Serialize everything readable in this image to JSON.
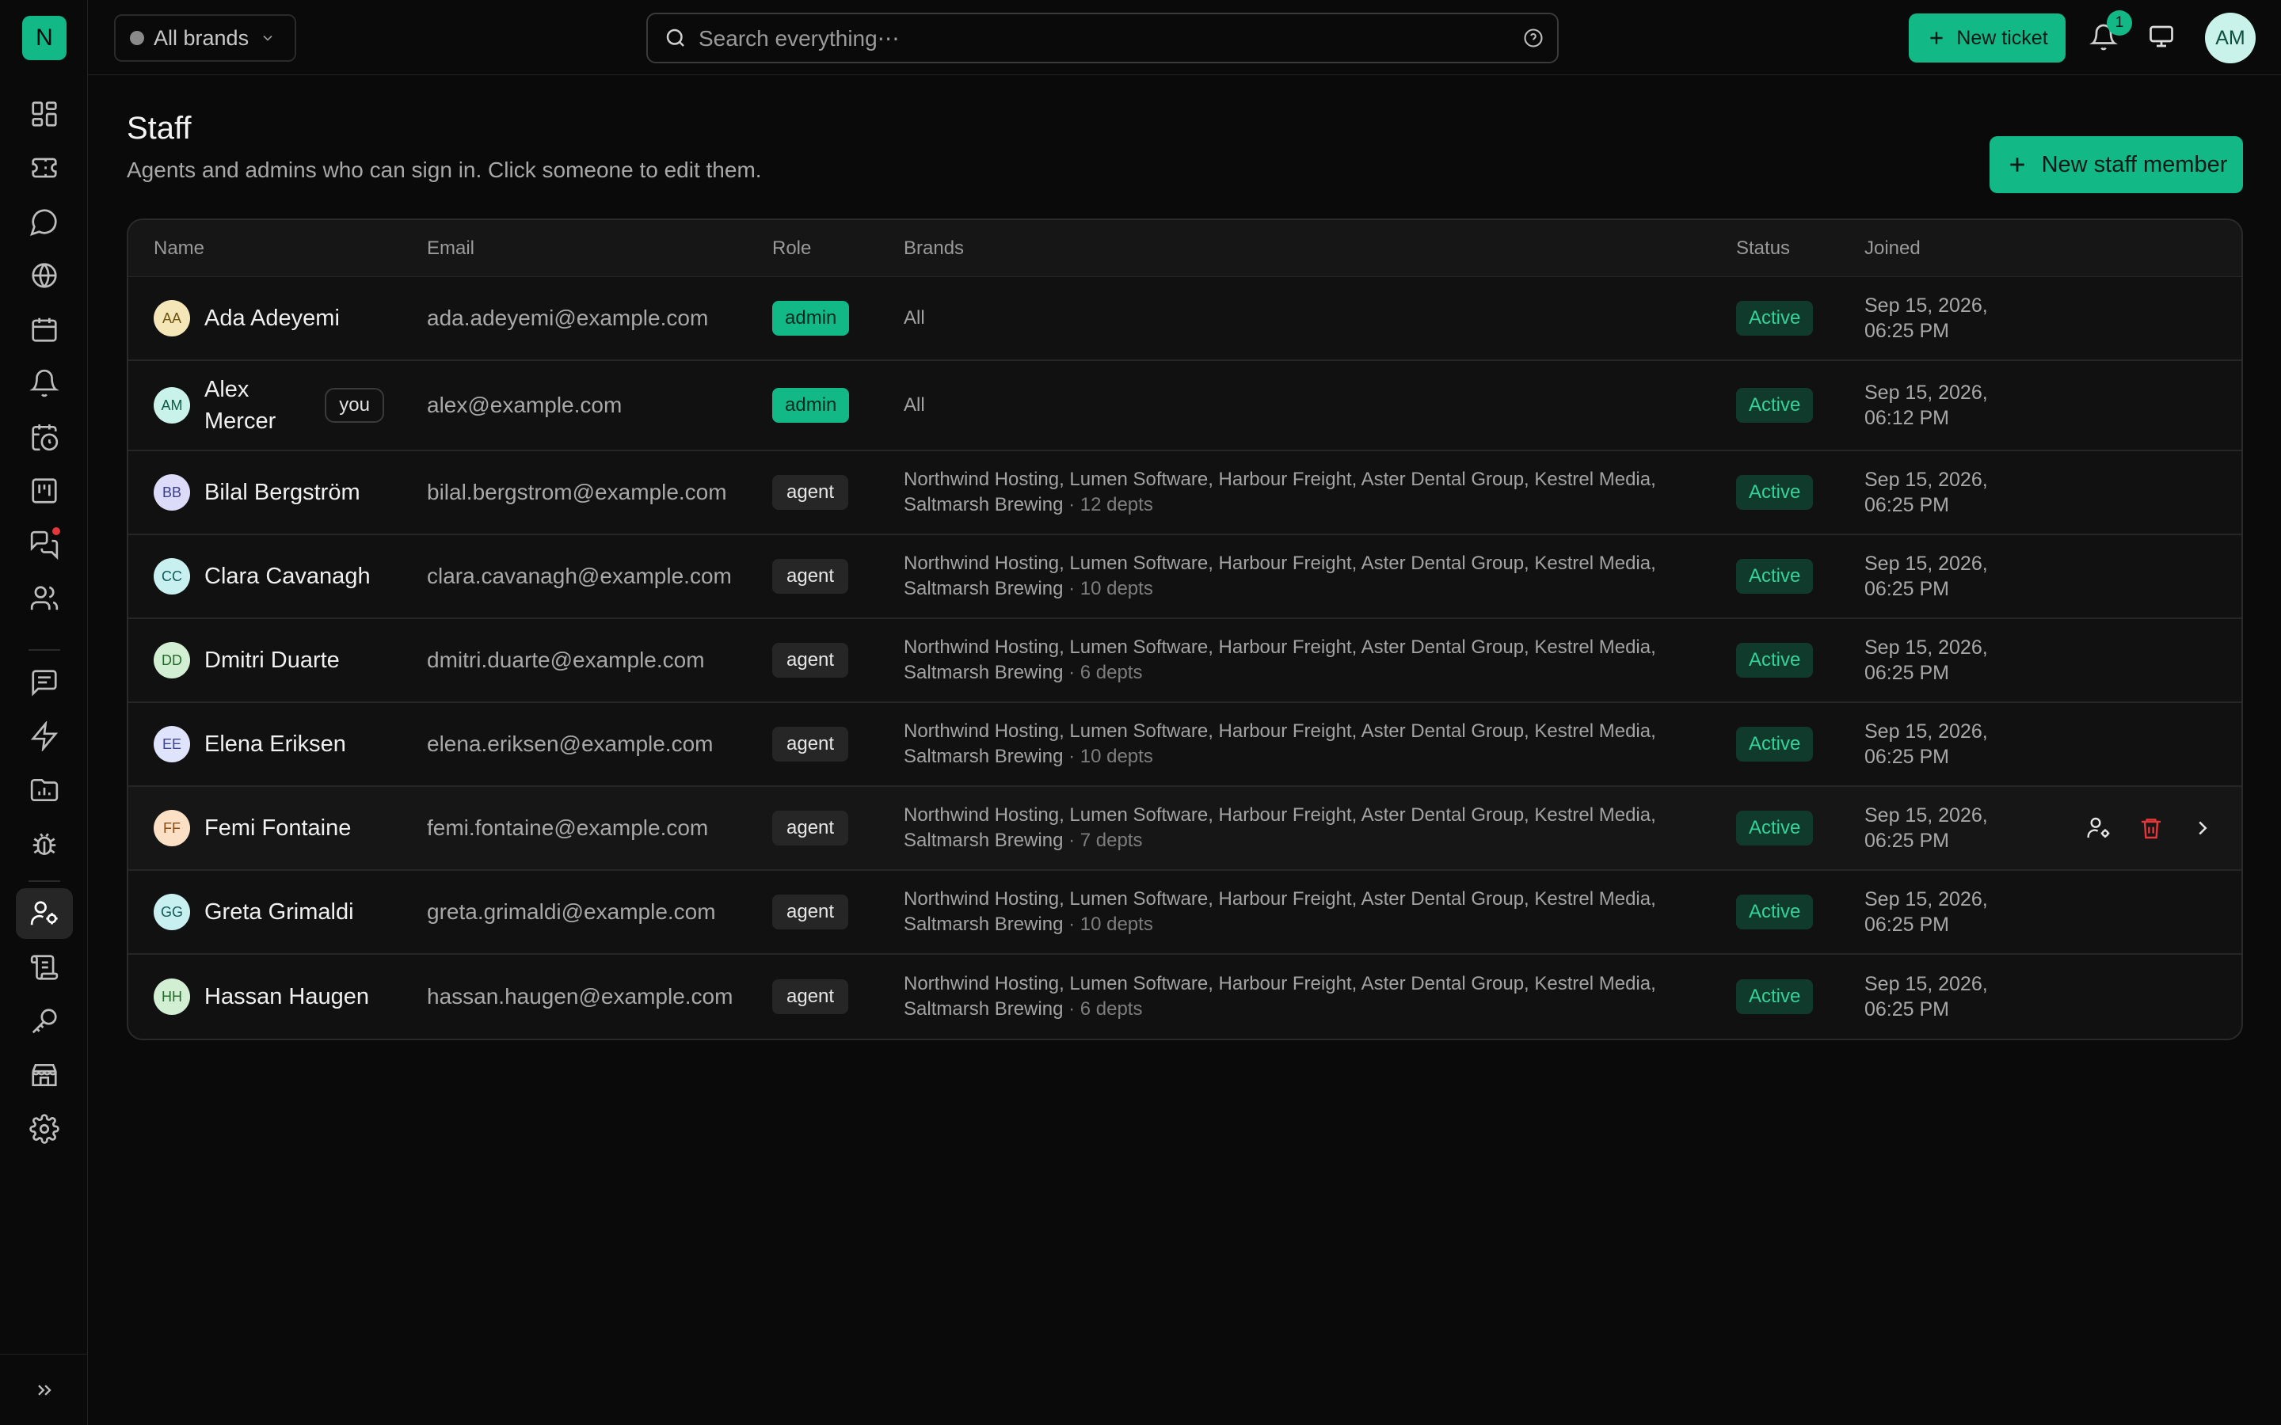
{
  "app": {
    "logo_letter": "N"
  },
  "topbar": {
    "brand_selector": "All brands",
    "search_placeholder": "Search everything⋯",
    "new_ticket": "New ticket",
    "notifications_count": "1",
    "user_initials": "AM"
  },
  "page": {
    "title": "Staff",
    "subtitle": "Agents and admins who can sign in. Click someone to edit them.",
    "new_staff_button": "New staff member"
  },
  "table": {
    "headers": {
      "name": "Name",
      "email": "Email",
      "role": "Role",
      "brands": "Brands",
      "status": "Status",
      "joined": "Joined"
    },
    "rows": [
      {
        "initials": "AA",
        "name": "Ada Adeyemi",
        "email": "ada.adeyemi@example.com",
        "role": "admin",
        "brands": "All",
        "depts": "",
        "status": "Active",
        "joined1": "Sep 15, 2026,",
        "joined2": "06:25 PM",
        "avatar_bg": "#f5e6b8",
        "avatar_fg": "#6b5210"
      },
      {
        "initials": "AM",
        "name1": "Alex",
        "name2": "Mercer",
        "you": "you",
        "email": "alex@example.com",
        "role": "admin",
        "brands": "All",
        "depts": "",
        "status": "Active",
        "joined1": "Sep 15, 2026,",
        "joined2": "06:12 PM",
        "avatar_bg": "#c9f2ea",
        "avatar_fg": "#0f5a48"
      },
      {
        "initials": "BB",
        "name": "Bilal Bergström",
        "email": "bilal.bergstrom@example.com",
        "role": "agent",
        "brands1": "Northwind Hosting, Lumen Software, Harbour Freight, Aster Dental Group, Kestrel Media,",
        "brands2": "Saltmarsh Brewing",
        "depts": " · 12 depts",
        "status": "Active",
        "joined1": "Sep 15, 2026,",
        "joined2": "06:25 PM",
        "avatar_bg": "#dcdcfa",
        "avatar_fg": "#3b3b8a"
      },
      {
        "initials": "CC",
        "name": "Clara Cavanagh",
        "email": "clara.cavanagh@example.com",
        "role": "agent",
        "brands1": "Northwind Hosting, Lumen Software, Harbour Freight, Aster Dental Group, Kestrel Media,",
        "brands2": "Saltmarsh Brewing",
        "depts": " · 10 depts",
        "status": "Active",
        "joined1": "Sep 15, 2026,",
        "joined2": "06:25 PM",
        "avatar_bg": "#c9f0f0",
        "avatar_fg": "#125a5a"
      },
      {
        "initials": "DD",
        "name": "Dmitri Duarte",
        "email": "dmitri.duarte@example.com",
        "role": "agent",
        "brands1": "Northwind Hosting, Lumen Software, Harbour Freight, Aster Dental Group, Kestrel Media,",
        "brands2": "Saltmarsh Brewing",
        "depts": " · 6 depts",
        "status": "Active",
        "joined1": "Sep 15, 2026,",
        "joined2": "06:25 PM",
        "avatar_bg": "#d3efd3",
        "avatar_fg": "#236b2a"
      },
      {
        "initials": "EE",
        "name": "Elena Eriksen",
        "email": "elena.eriksen@example.com",
        "role": "agent",
        "brands1": "Northwind Hosting, Lumen Software, Harbour Freight, Aster Dental Group, Kestrel Media,",
        "brands2": "Saltmarsh Brewing",
        "depts": " · 10 depts",
        "status": "Active",
        "joined1": "Sep 15, 2026,",
        "joined2": "06:25 PM",
        "avatar_bg": "#dfe3fb",
        "avatar_fg": "#3a4595"
      },
      {
        "initials": "FF",
        "name": "Femi Fontaine",
        "email": "femi.fontaine@example.com",
        "role": "agent",
        "brands1": "Northwind Hosting, Lumen Software, Harbour Freight, Aster Dental Group, Kestrel Media,",
        "brands2": "Saltmarsh Brewing",
        "depts": " · 7 depts",
        "status": "Active",
        "joined1": "Sep 15, 2026,",
        "joined2": "06:25 PM",
        "avatar_bg": "#fbe0c6",
        "avatar_fg": "#8a4a12"
      },
      {
        "initials": "GG",
        "name": "Greta Grimaldi",
        "email": "greta.grimaldi@example.com",
        "role": "agent",
        "brands1": "Northwind Hosting, Lumen Software, Harbour Freight, Aster Dental Group, Kestrel Media,",
        "brands2": "Saltmarsh Brewing",
        "depts": " · 10 depts",
        "status": "Active",
        "joined1": "Sep 15, 2026,",
        "joined2": "06:25 PM",
        "avatar_bg": "#c9f0f0",
        "avatar_fg": "#125a5a"
      },
      {
        "initials": "HH",
        "name": "Hassan Haugen",
        "email": "hassan.haugen@example.com",
        "role": "agent",
        "brands1": "Northwind Hosting, Lumen Software, Harbour Freight, Aster Dental Group, Kestrel Media,",
        "brands2": "Saltmarsh Brewing",
        "depts": " · 6 depts",
        "status": "Active",
        "joined1": "Sep 15, 2026,",
        "joined2": "06:25 PM",
        "avatar_bg": "#d3efd3",
        "avatar_fg": "#236b2a"
      }
    ]
  },
  "colors": {
    "accent": "#12b886",
    "active_text": "#34d399",
    "danger": "#e5383b"
  },
  "icons": [
    "dashboard-icon",
    "ticket-icon",
    "chat-icon",
    "globe-icon",
    "calendar-icon",
    "bell-icon",
    "calendar-clock-icon",
    "kanban-icon",
    "messages-icon",
    "users-icon",
    "document-icon",
    "bolt-icon",
    "chart-folder-icon",
    "bug-icon",
    "user-cog-icon",
    "scroll-icon",
    "key-icon",
    "store-icon",
    "gear-icon",
    "expand-icon"
  ]
}
